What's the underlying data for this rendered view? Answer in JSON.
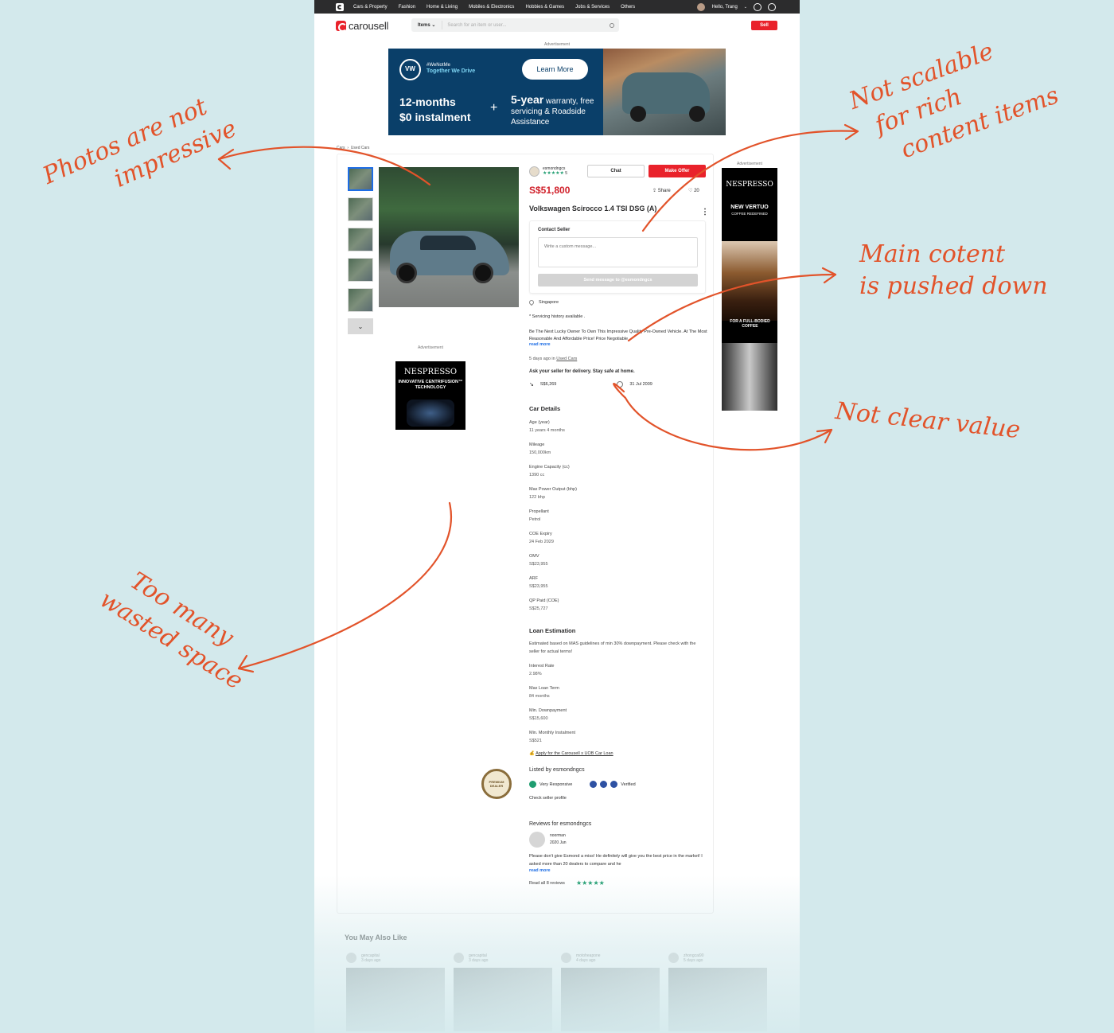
{
  "topnav": {
    "categories": [
      "Cars & Property",
      "Fashion",
      "Home & Living",
      "Mobiles & Electronics",
      "Hobbies & Games",
      "Jobs & Services",
      "Others"
    ],
    "greeting": "Hello, Trang"
  },
  "header": {
    "brand": "carousell",
    "items_dropdown": "Items",
    "search_placeholder": "Search for an item or user...",
    "sell_label": "Sell"
  },
  "banner": {
    "label": "Advertisement",
    "tagline1": "#WeNotMe",
    "tagline2": "Together We Drive",
    "cta": "Learn More",
    "offer_line1": "12-months",
    "offer_line2": "$0 instalment",
    "warranty_big": "5-year",
    "warranty_rest": "warranty, free servicing & Roadside Assistance"
  },
  "breadcrumb": [
    "Cars",
    "Used Cars"
  ],
  "listing": {
    "seller": "esmondngcs",
    "rating_count": "5",
    "chat_label": "Chat",
    "offer_label": "Make Offer",
    "price": "S$51,800",
    "share_label": "Share",
    "likes": "20",
    "title": "Volkswagen Scirocco 1.4 TSI DSG (A)",
    "contact": {
      "label": "Contact Seller",
      "placeholder": "Write a custom message...",
      "send_label": "Send message to @esmondngcs"
    },
    "location": "Singapore",
    "desc1": "* Servicing history available .",
    "desc2": "Be The Next Lucky Owner To Own This Impressive Quality Pre-Owned Vehicle. At The Most Reasonable And Affordable Price! Price Negotiable",
    "read_more": "read more",
    "posted": "5 days ago in",
    "posted_category": "Used Cars",
    "delivery": "Ask your seller for delivery. Stay safe at home.",
    "depreciation": "S$6,269",
    "reg_date": "31 Jul 2009"
  },
  "car_details": {
    "heading": "Car Details",
    "specs": [
      {
        "k": "Age (year)",
        "v": "11 years 4 months"
      },
      {
        "k": "Mileage",
        "v": "150,000km"
      },
      {
        "k": "Engine Capacity (cc)",
        "v": "1390 cc"
      },
      {
        "k": "Max Power Output (bhp)",
        "v": "122 bhp"
      },
      {
        "k": "Propellant",
        "v": "Petrol"
      },
      {
        "k": "COE Expiry",
        "v": "24 Feb 2029"
      },
      {
        "k": "OMV",
        "v": "S$23,955"
      },
      {
        "k": "ARF",
        "v": "S$23,955"
      },
      {
        "k": "QP Paid (COE)",
        "v": "S$25,727"
      }
    ]
  },
  "loan": {
    "heading": "Loan Estimation",
    "note": "Estimated based on MAS guidelines of min 30% downpayment. Please check with the seller for actual terms!",
    "specs": [
      {
        "k": "Interest Rate",
        "v": "2.98%"
      },
      {
        "k": "Max Loan Term",
        "v": "84 months"
      },
      {
        "k": "Min. Downpayment",
        "v": "S$15,600"
      },
      {
        "k": "Min. Monthly Instalment",
        "v": "S$521"
      }
    ],
    "apply": "Apply for the Carousell x UOB Car Loan"
  },
  "seller_info": {
    "listed_by": "Listed by esmondngcs",
    "responsive": "Very Responsive",
    "verified": "Verified",
    "premium": "PREMIUM DEALER",
    "check_profile": "Check seller profile"
  },
  "reviews": {
    "heading": "Reviews for esmondngcs",
    "reviewer": "noorman",
    "date": "2020 Jun",
    "text": "Please don't give Esmond a miss! He definitely will give you the best price in the market! I asked more than 20 dealers to compare and he",
    "read_more": "read more",
    "read_all": "Read all 8 reviews"
  },
  "ads": {
    "label": "Advertisement",
    "left_brand": "NESPRESSO",
    "left_text": "INNOVATIVE CENTRIFUSION™ TECHNOLOGY",
    "right_brand": "NESPRESSO",
    "right_product": "NEW VERTUO",
    "right_tagline": "COFFEE REDEFINED",
    "right_bottom": "FOR A FULL-BODIED COFFEE"
  },
  "related": {
    "heading": "You May Also Like",
    "items": [
      {
        "user": "gencapital",
        "time": "3 days ago"
      },
      {
        "user": "gencapital",
        "time": "3 days ago"
      },
      {
        "user": "motoheapone",
        "time": "4 days ago"
      },
      {
        "user": "zhongcai90",
        "time": "5 days ago"
      }
    ]
  },
  "annotations": {
    "photos_line1": "Photos are not",
    "photos_line2": "impressive",
    "scalable_line1": "Not scalable",
    "scalable_line2": "for rich",
    "scalable_line3": "content items",
    "main_line1": "Main cotent",
    "main_line2": "is pushed down",
    "value": "Not clear value",
    "wasted_line1": "Too many",
    "wasted_line2": "wasted space"
  },
  "colors": {
    "background": "#d3e9ec",
    "annotation": "#e2532a",
    "brand_red": "#e9222b",
    "price_red": "#d0202a",
    "link_blue": "#1d6de5",
    "star_green": "#1f9d70"
  }
}
